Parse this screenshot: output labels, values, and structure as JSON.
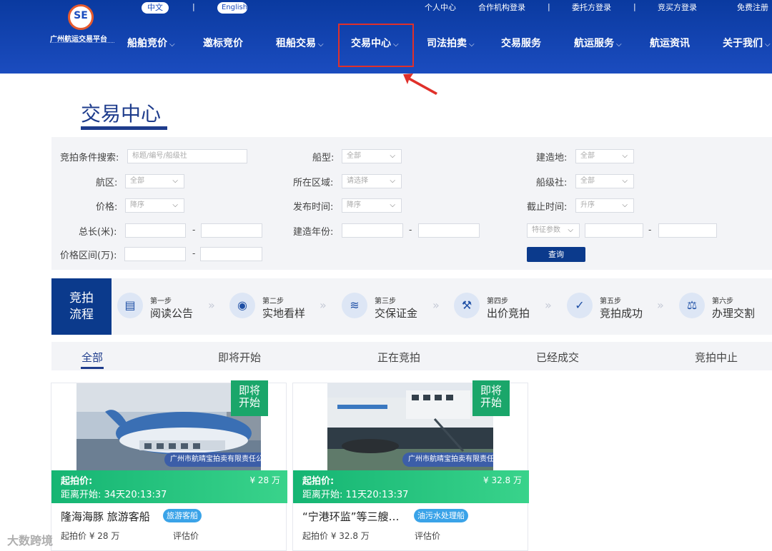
{
  "header": {
    "logo_mark": "SE",
    "logo_text": "广州航运交易平台",
    "lang_cn": "中文",
    "lang_en": "English",
    "sep": "|",
    "top_links": [
      "个人中心",
      "合作机构登录",
      "委托方登录",
      "竞买方登录",
      "免费注册"
    ],
    "nav": [
      "船舶竞价",
      "邀标竞价",
      "租船交易",
      "交易中心",
      "司法拍卖",
      "交易服务",
      "航运服务",
      "航运资讯",
      "关于我们"
    ],
    "chevron": "⌵"
  },
  "page": {
    "title": "交易中心"
  },
  "search": {
    "keyword_label": "竞拍条件搜索:",
    "keyword_placeholder": "标题/编号/船级社",
    "ship_type_label": "船型:",
    "ship_type_value": "全部",
    "build_place_label": "建造地:",
    "build_place_value": "全部",
    "area_label": "航区:",
    "area_value": "全部",
    "region_label": "所在区域:",
    "region_value": "请选择",
    "class_label": "船级社:",
    "class_value": "全部",
    "price_label": "价格:",
    "price_value": "降序",
    "publish_label": "发布时间:",
    "publish_value": "降序",
    "deadline_label": "截止时间:",
    "deadline_value": "升序",
    "length_label": "总长(米):",
    "year_label": "建造年份:",
    "feature_value": "特征参数",
    "range_label": "价格区间(万):",
    "dash": "-",
    "query_button": "查询"
  },
  "process": {
    "title_line1": "竞拍",
    "title_line2": "流程",
    "steps": [
      {
        "no": "第一步",
        "name": "阅读公告",
        "icon": "document-icon"
      },
      {
        "no": "第二步",
        "name": "实地看样",
        "icon": "location-icon"
      },
      {
        "no": "第三步",
        "name": "交保证金",
        "icon": "coins-icon"
      },
      {
        "no": "第四步",
        "name": "出价竞拍",
        "icon": "gavel-icon"
      },
      {
        "no": "第五步",
        "name": "竞拍成功",
        "icon": "check-icon"
      },
      {
        "no": "第六步",
        "name": "办理交割",
        "icon": "scale-icon"
      }
    ],
    "arrow": "»"
  },
  "tabs": [
    "全部",
    "即将开始",
    "正在竞拍",
    "已经成交",
    "竞拍中止"
  ],
  "cards": [
    {
      "badge_line1": "即将",
      "badge_line2": "开始",
      "company": "广州市航晴宝拍卖有限责任公司",
      "start_price_label": "起拍价:",
      "price_value": "¥ 28 万",
      "countdown": "距离开始: 34天20:13:37",
      "name": "隆海海豚 旅游客船",
      "tag": "旅游客船",
      "meta_start": "起拍价 ¥ 28 万",
      "meta_eval": "评估价"
    },
    {
      "badge_line1": "即将",
      "badge_line2": "开始",
      "company": "广州市航晴宝拍卖有限责任公司",
      "start_price_label": "起拍价:",
      "price_value": "¥ 32.8 万",
      "countdown": "距离开始: 11天20:13:37",
      "name": "“宁港环监”等三艘…",
      "tag": "油污水处理船",
      "meta_start": "起拍价 ¥ 32.8 万",
      "meta_eval": "评估价"
    }
  ],
  "watermark": "大数跨境",
  "colors": {
    "header": "#0a3aa0",
    "accent": "#1e3c8c",
    "green": "#15b573",
    "highlight_box": "#e0302a"
  }
}
